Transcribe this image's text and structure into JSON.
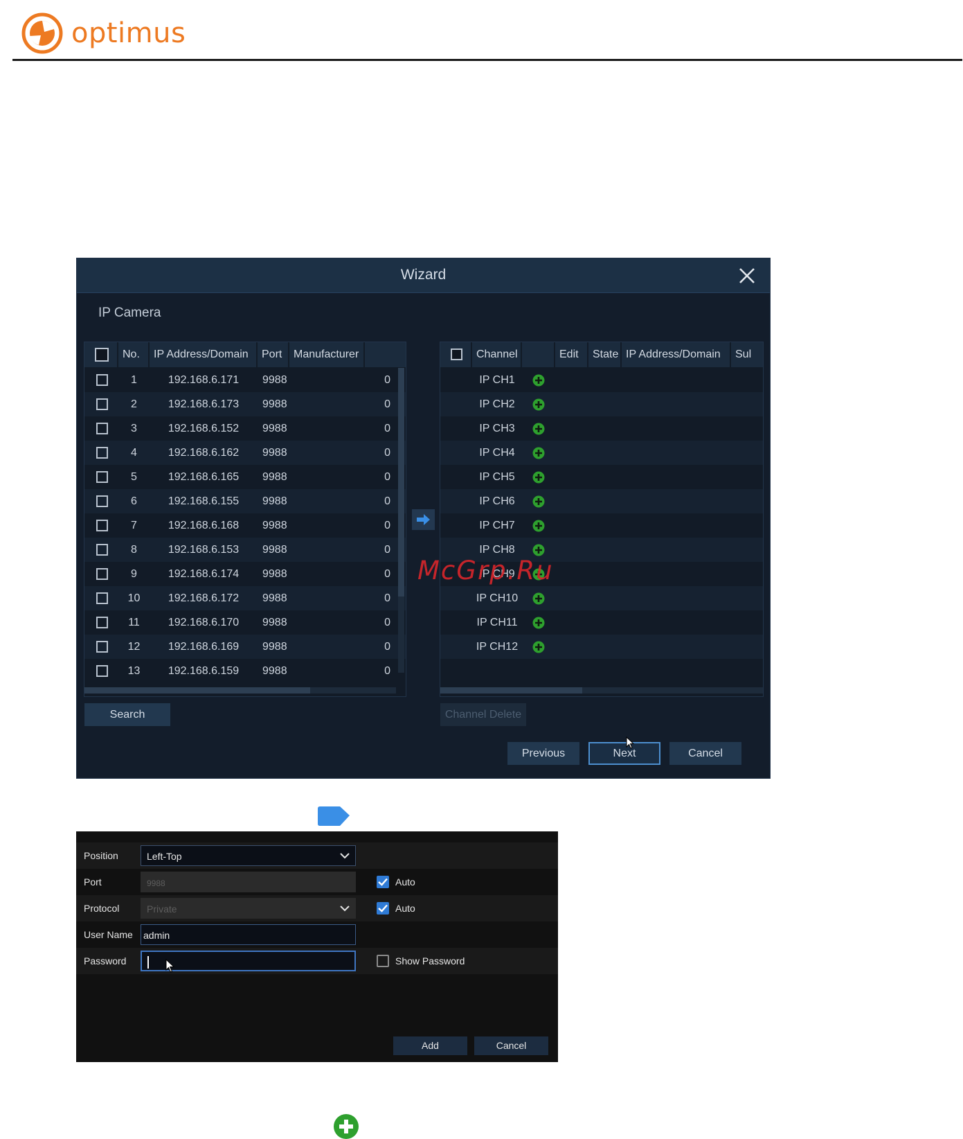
{
  "brand": {
    "name": "optimus",
    "color": "#ed7a22"
  },
  "wizard": {
    "title": "Wizard",
    "section": "IP Camera",
    "left_table": {
      "columns": [
        "No.",
        "IP Address/Domain",
        "Port",
        "Manufacturer"
      ],
      "rows": [
        {
          "no": "1",
          "ip": "192.168.6.171",
          "port": "9988",
          "manufacturer": "0"
        },
        {
          "no": "2",
          "ip": "192.168.6.173",
          "port": "9988",
          "manufacturer": "0"
        },
        {
          "no": "3",
          "ip": "192.168.6.152",
          "port": "9988",
          "manufacturer": "0"
        },
        {
          "no": "4",
          "ip": "192.168.6.162",
          "port": "9988",
          "manufacturer": "0"
        },
        {
          "no": "5",
          "ip": "192.168.6.165",
          "port": "9988",
          "manufacturer": "0"
        },
        {
          "no": "6",
          "ip": "192.168.6.155",
          "port": "9988",
          "manufacturer": "0"
        },
        {
          "no": "7",
          "ip": "192.168.6.168",
          "port": "9988",
          "manufacturer": "0"
        },
        {
          "no": "8",
          "ip": "192.168.6.153",
          "port": "9988",
          "manufacturer": "0"
        },
        {
          "no": "9",
          "ip": "192.168.6.174",
          "port": "9988",
          "manufacturer": "0"
        },
        {
          "no": "10",
          "ip": "192.168.6.172",
          "port": "9988",
          "manufacturer": "0"
        },
        {
          "no": "11",
          "ip": "192.168.6.170",
          "port": "9988",
          "manufacturer": "0"
        },
        {
          "no": "12",
          "ip": "192.168.6.169",
          "port": "9988",
          "manufacturer": "0"
        },
        {
          "no": "13",
          "ip": "192.168.6.159",
          "port": "9988",
          "manufacturer": "0"
        }
      ]
    },
    "right_table": {
      "columns": [
        "Channel",
        "",
        "Edit",
        "State",
        "IP Address/Domain",
        "Sul"
      ],
      "rows": [
        "IP CH1",
        "IP CH2",
        "IP CH3",
        "IP CH4",
        "IP CH5",
        "IP CH6",
        "IP CH7",
        "IP CH8",
        "IP CH9",
        "IP CH10",
        "IP CH11",
        "IP CH12"
      ]
    },
    "buttons": {
      "search": "Search",
      "channel_delete": "Channel Delete",
      "previous": "Previous",
      "next": "Next",
      "cancel": "Cancel"
    }
  },
  "add_dialog": {
    "fields": {
      "position": {
        "label": "Position",
        "value": "Left-Top"
      },
      "port": {
        "label": "Port",
        "value": "9988",
        "auto_label": "Auto"
      },
      "protocol": {
        "label": "Protocol",
        "value": "Private",
        "auto_label": "Auto"
      },
      "username": {
        "label": "User Name",
        "value": "admin"
      },
      "password": {
        "label": "Password",
        "value": "",
        "show_label": "Show Password"
      }
    },
    "buttons": {
      "add": "Add",
      "cancel": "Cancel"
    }
  },
  "watermark": "McGrp.Ru",
  "colors": {
    "accent_blue": "#2f7bd6",
    "plus_green": "#2ea02e",
    "arrow_blue": "#3a8fe6"
  }
}
